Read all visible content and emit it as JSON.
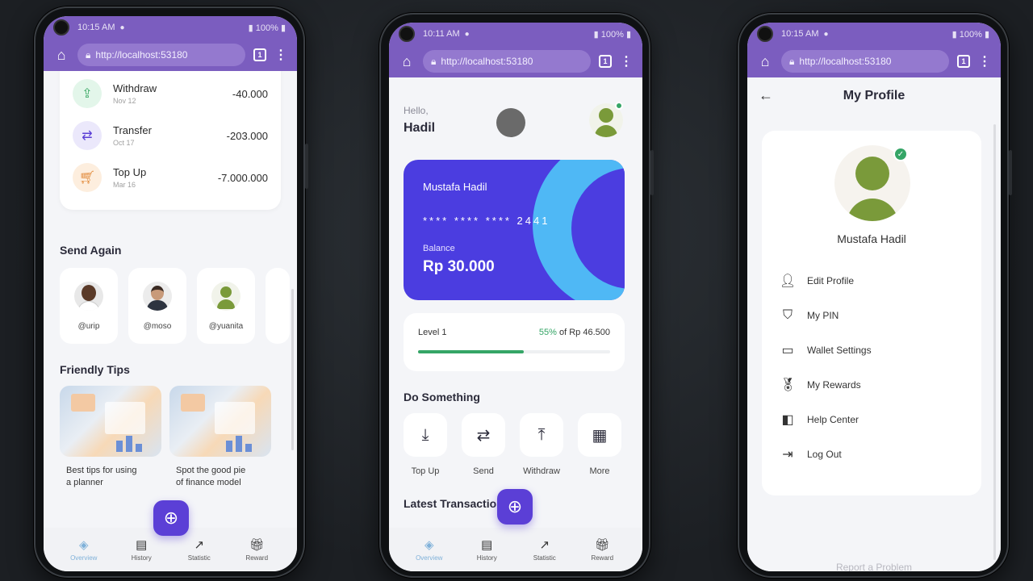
{
  "browser": {
    "url": "http://localhost:53180",
    "tab_count": "1"
  },
  "phone1": {
    "status_time": "10:15 AM",
    "battery": "100%",
    "transactions": [
      {
        "title": "Withdraw",
        "date": "Nov 12",
        "amount": "-40.000"
      },
      {
        "title": "Transfer",
        "date": "Oct 17",
        "amount": "-203.000"
      },
      {
        "title": "Top Up",
        "date": "Mar 16",
        "amount": "-7.000.000"
      }
    ],
    "send_again_title": "Send Again",
    "send_again": [
      {
        "name": "@urip"
      },
      {
        "name": "@moso"
      },
      {
        "name": "@yuanita"
      }
    ],
    "tips_title": "Friendly Tips",
    "tips": [
      {
        "text_line1": "Best tips for using",
        "text_line2": "a planner"
      },
      {
        "text_line1": "Spot the good pie",
        "text_line2": "of finance model"
      }
    ]
  },
  "phone2": {
    "status_time": "10:11 AM",
    "battery": "100%",
    "greeting": "Hello,",
    "user_first_name": "Hadil",
    "card": {
      "holder": "Mustafa Hadil",
      "number": "**** **** **** 2441",
      "balance_label": "Balance",
      "balance": "Rp 30.000"
    },
    "level": {
      "label": "Level 1",
      "percent_text": "55%",
      "of_text": "of Rp 46.500",
      "progress": 0.55
    },
    "do_something_title": "Do Something",
    "actions": [
      {
        "label": "Top Up"
      },
      {
        "label": "Send"
      },
      {
        "label": "Withdraw"
      },
      {
        "label": "More"
      }
    ],
    "latest_title": "Latest Transactions"
  },
  "phone3": {
    "status_time": "10:15 AM",
    "battery": "100%",
    "title": "My Profile",
    "user_name": "Mustafa Hadil",
    "menu": [
      {
        "label": "Edit Profile",
        "icon": "person-icon"
      },
      {
        "label": "My PIN",
        "icon": "shield-icon"
      },
      {
        "label": "Wallet Settings",
        "icon": "wallet-icon"
      },
      {
        "label": "My Rewards",
        "icon": "medal-icon"
      },
      {
        "label": "Help Center",
        "icon": "help-icon"
      },
      {
        "label": "Log Out",
        "icon": "logout-icon"
      }
    ],
    "footer_link": "Report a Problem"
  },
  "nav": {
    "overview": "Overview",
    "history": "History",
    "statistic": "Statistic",
    "reward": "Reward"
  },
  "colors": {
    "browser_purple": "#7b5dbf",
    "primary": "#5b3fd6",
    "card_blue": "#4b3de0",
    "card_accent": "#4fb8f5",
    "success_green": "#35a566",
    "avatar_green": "#7a9a3a"
  }
}
